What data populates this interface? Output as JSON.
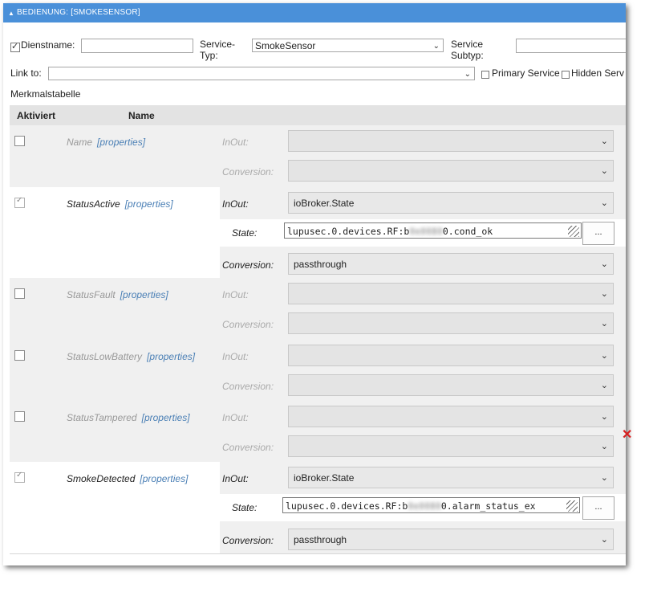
{
  "panel": {
    "title": "Bedienung: [SmokeSensor]"
  },
  "form": {
    "dienstname_label": "Dienstname:",
    "dienstname_value": "",
    "service_typ_label_1": "Service-",
    "service_typ_label_2": "Typ:",
    "service_typ_value": "SmokeSensor",
    "service_subtyp_label_1": "Service",
    "service_subtyp_label_2": "Subtyp:",
    "service_subtyp_value": "",
    "link_to_label": "Link to:",
    "link_to_value": "",
    "primary_service_label": "Primary Service",
    "hidden_service_label": "Hidden Serv"
  },
  "table": {
    "section_label": "Merkmalstabelle",
    "col_aktiviert": "Aktiviert",
    "col_name": "Name",
    "properties_label": "[properties]",
    "inout_label": "InOut:",
    "conversion_label": "Conversion:",
    "state_label": "State:",
    "dots_label": "...",
    "rows": [
      {
        "name": "Name",
        "active": false
      },
      {
        "name": "StatusActive",
        "active": true,
        "inout": "ioBroker.State",
        "state_prefix": "lupusec.0.devices.RF:b",
        "state_blur": "0e0080",
        "state_suffix": "0.cond_ok",
        "conversion": "passthrough"
      },
      {
        "name": "StatusFault",
        "active": false
      },
      {
        "name": "StatusLowBattery",
        "active": false
      },
      {
        "name": "StatusTampered",
        "active": false
      },
      {
        "name": "SmokeDetected",
        "active": true,
        "inout": "ioBroker.State",
        "state_prefix": "lupusec.0.devices.RF:b",
        "state_blur": "0e0080",
        "state_suffix": "0.alarm_status_ex",
        "conversion": "passthrough"
      }
    ]
  },
  "icons": {
    "collapse": "triangle-down-icon",
    "dropdown": "chevron-down-icon",
    "delete": "close-icon",
    "resize": "resize-grip-icon"
  },
  "colors": {
    "header": "#4a90d9",
    "link": "#4a7fb5",
    "delete": "#d62020"
  }
}
